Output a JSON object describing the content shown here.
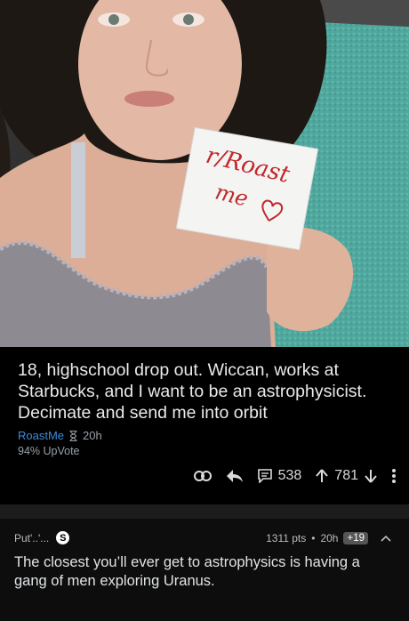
{
  "photo": {
    "sign_line1": "r/Roast",
    "sign_line2": "me"
  },
  "post": {
    "title": "18, highschool drop out. Wiccan, works at Starbucks, and I want to be an astrophysicist. Decimate and send me into orbit",
    "subreddit": "RoastMe",
    "age": "20h",
    "upvote_ratio": "94% UpVote",
    "comments": "538",
    "score": "781"
  },
  "comment": {
    "author": "Put'..'...",
    "points": "1311 pts",
    "age": "20h",
    "gilded": "+19",
    "body": "The closest you’ll ever get to astrophysics is having a gang of men exploring Uranus."
  }
}
